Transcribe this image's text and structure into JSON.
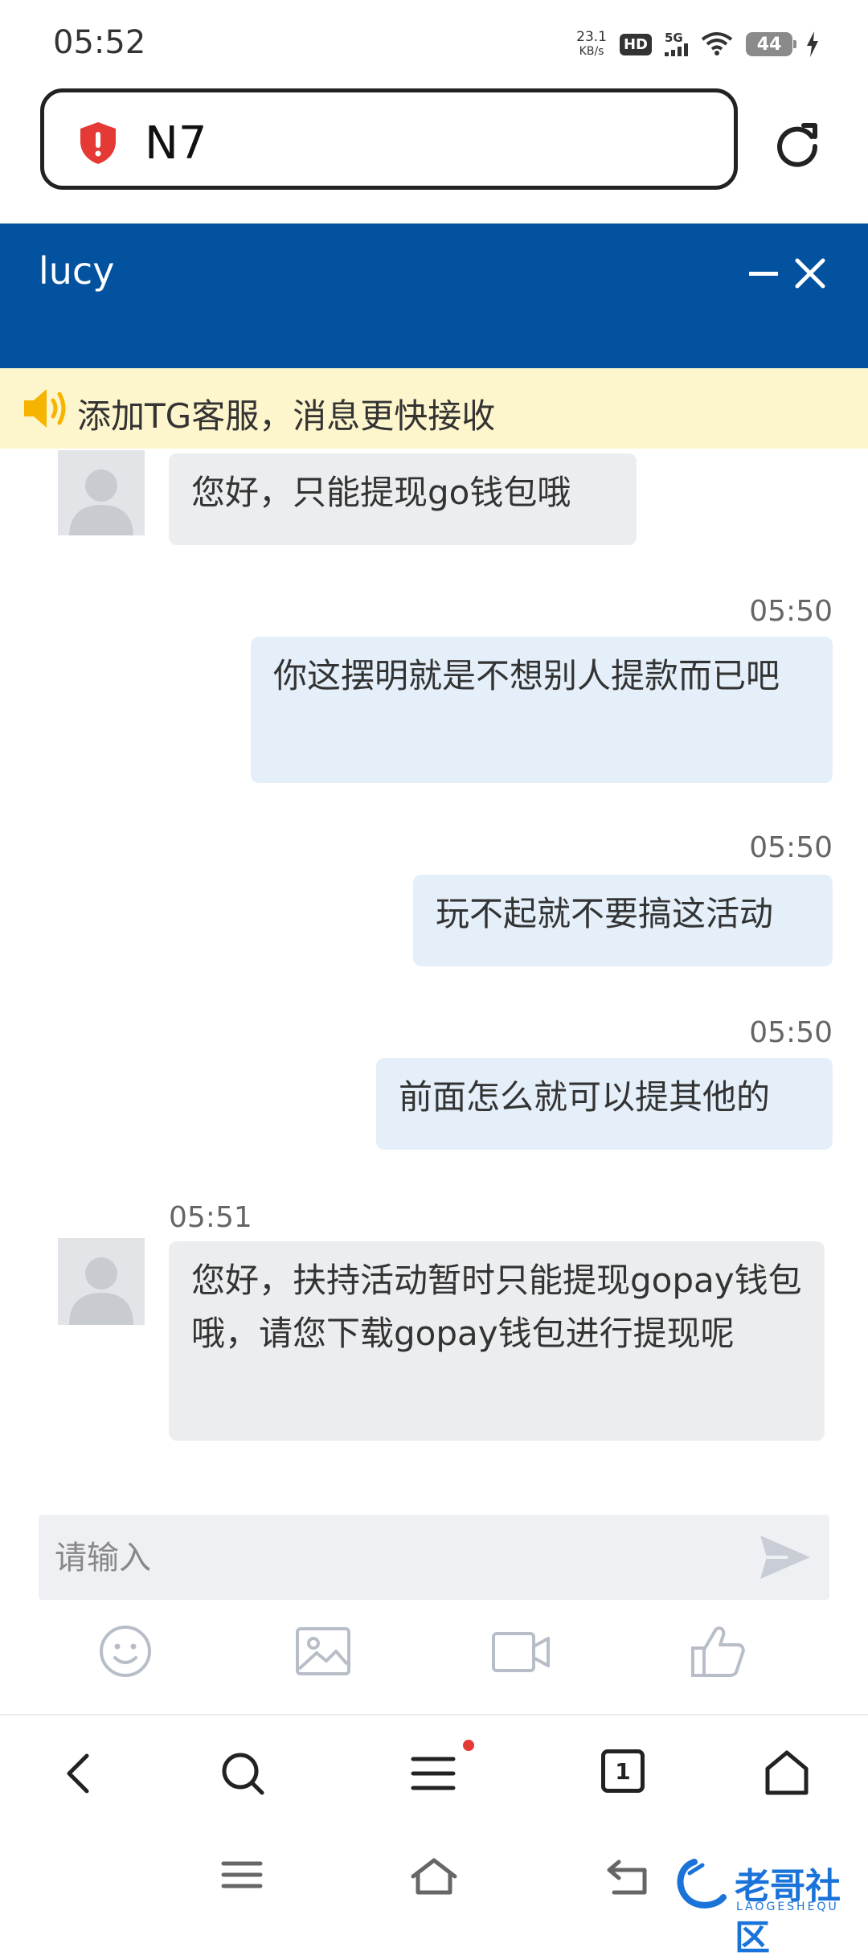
{
  "status_bar": {
    "time": "05:52",
    "net_speed_value": "23.1",
    "net_speed_unit": "KB/s",
    "hd_badge": "HD",
    "network": "5G",
    "battery": "44"
  },
  "address_bar": {
    "title": "N7",
    "security_icon": "red-shield-alert-icon",
    "reload_icon": "reload-icon"
  },
  "chat": {
    "agent_name": "lucy",
    "notice": "添加TG客服，消息更快接收",
    "messages": [
      {
        "direction": "in",
        "time": "",
        "text": "您好，只能提现go钱包哦"
      },
      {
        "direction": "out",
        "time": "05:50",
        "text": "你这摆明就是不想别人提款而已吧"
      },
      {
        "direction": "out",
        "time": "05:50",
        "text": "玩不起就不要搞这活动"
      },
      {
        "direction": "out",
        "time": "05:50",
        "text": "前面怎么就可以提其他的"
      },
      {
        "direction": "in",
        "time": "05:51",
        "text": "您好，扶持活动暂时只能提现gopay钱包哦，请您下载gopay钱包进行提现呢"
      }
    ],
    "input_placeholder": "请输入",
    "tools": [
      "emoji-icon",
      "image-icon",
      "video-icon",
      "thumbs-up-icon"
    ]
  },
  "browser_nav": {
    "tab_count": "1"
  },
  "watermark": {
    "text": "老哥社区",
    "subtext": "LAOGESHEQU"
  },
  "colors": {
    "header_blue": "#0352a0",
    "notice_bg": "#fdf5cc",
    "bubble_in": "#ebedef",
    "bubble_out": "#e4eff9",
    "alert_red": "#e53935"
  }
}
